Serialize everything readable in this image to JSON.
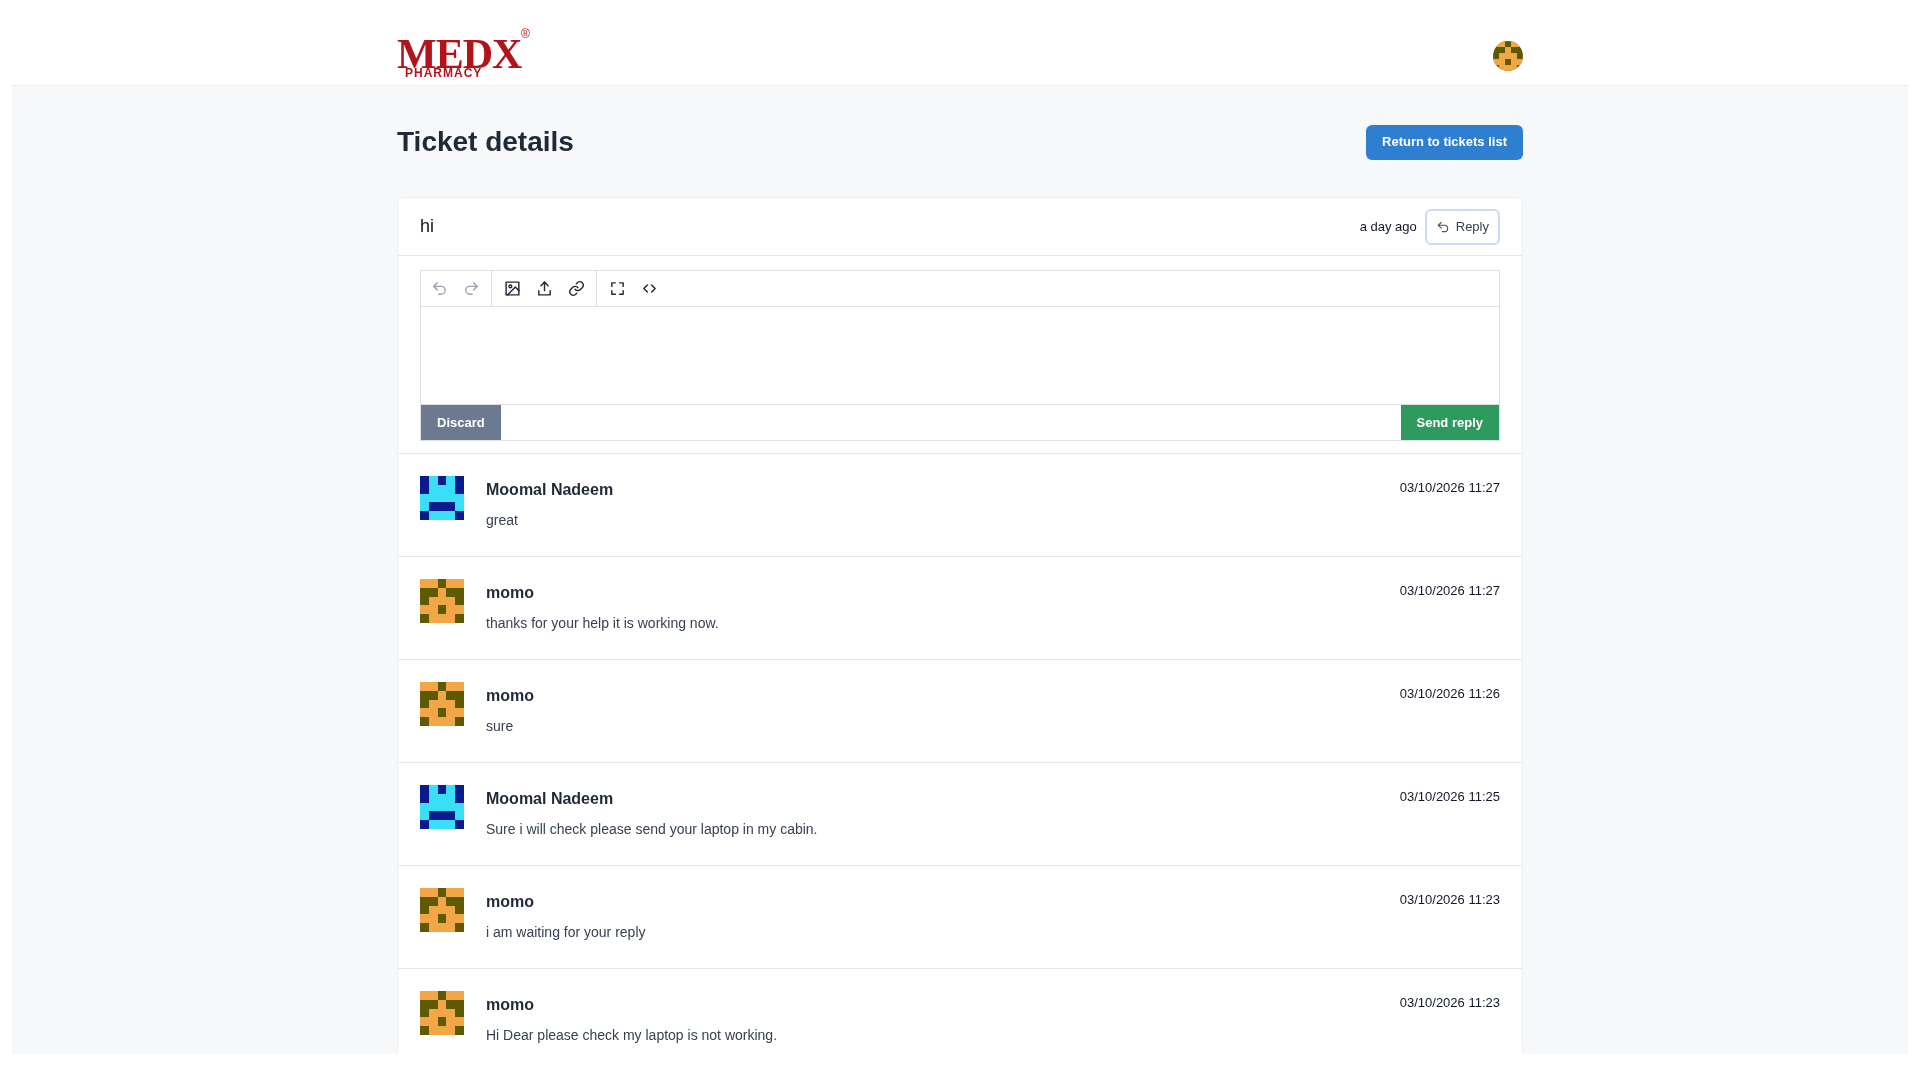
{
  "header": {
    "logo": {
      "brand": "MEDX",
      "registered": "®",
      "sub": "PHARMACY"
    },
    "user_avatar": {
      "kind": "face"
    }
  },
  "page": {
    "title": "Ticket details",
    "return_button": "Return to tickets list"
  },
  "ticket": {
    "subject": "hi",
    "time": "a day ago",
    "reply_button": "Reply"
  },
  "editor": {
    "toolbar": [
      [
        {
          "kind": "undo",
          "disabled": true
        },
        {
          "kind": "redo",
          "disabled": true
        }
      ],
      [
        {
          "kind": "image",
          "disabled": false
        },
        {
          "kind": "upload",
          "disabled": false
        },
        {
          "kind": "link",
          "disabled": false
        }
      ],
      [
        {
          "kind": "fullscreen",
          "disabled": false
        },
        {
          "kind": "code",
          "disabled": false
        }
      ]
    ],
    "discard_button": "Discard",
    "send_button": "Send reply"
  },
  "messages": [
    {
      "author": "Moomal Nadeem",
      "avatar": {
        "kind": "robot"
      },
      "time": "03/10/2026 11:27",
      "text": "great"
    },
    {
      "author": "momo",
      "avatar": {
        "kind": "face"
      },
      "time": "03/10/2026 11:27",
      "text": "thanks for your help it is working now."
    },
    {
      "author": "momo",
      "avatar": {
        "kind": "face"
      },
      "time": "03/10/2026 11:26",
      "text": "sure"
    },
    {
      "author": "Moomal Nadeem",
      "avatar": {
        "kind": "robot"
      },
      "time": "03/10/2026 11:25",
      "text": "Sure i will check please send your laptop in my cabin."
    },
    {
      "author": "momo",
      "avatar": {
        "kind": "face"
      },
      "time": "03/10/2026 11:23",
      "text": "i am waiting for your reply"
    },
    {
      "author": "momo",
      "avatar": {
        "kind": "face"
      },
      "time": "03/10/2026 11:23",
      "text": "Hi Dear please check my laptop is not working."
    }
  ]
}
